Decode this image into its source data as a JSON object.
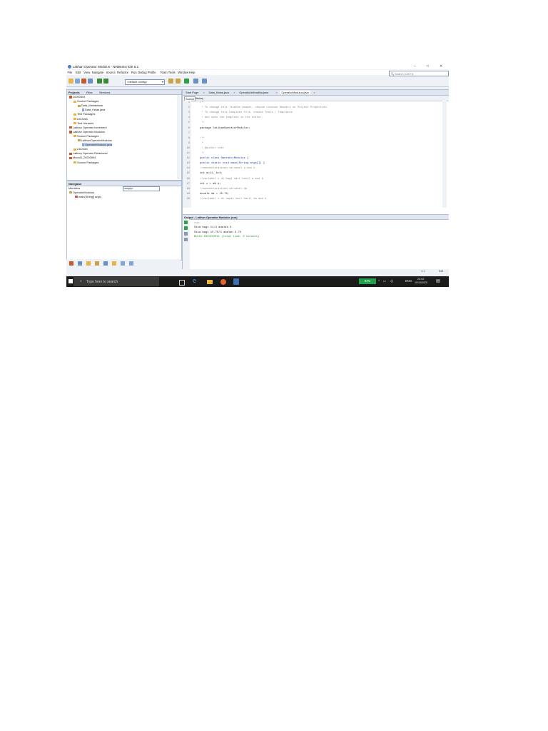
{
  "window": {
    "title": "Latihan Operator Modulus - NetBeans IDE 8.2",
    "controls": [
      "–",
      "□",
      "✕"
    ]
  },
  "menu": {
    "items": [
      "File",
      "Edit",
      "View",
      "Navigate",
      "Source",
      "Refactor",
      "Run",
      "Debug",
      "Profile",
      "Team",
      "Tools",
      "Window",
      "Help"
    ],
    "search_placeholder": "Search (Ctrl+I)"
  },
  "toolbar": {
    "config_value": "<default config>",
    "icons": [
      "new-project-icon",
      "new-file-icon",
      "open-project-icon",
      "save-all-icon",
      "undo-icon",
      "redo-icon",
      "build-icon",
      "clean-build-icon",
      "run-icon",
      "debug-icon",
      "profile-icon"
    ]
  },
  "projects_pane": {
    "tabs": [
      "Projects",
      "Files",
      "Services"
    ],
    "tree": [
      {
        "label": "20200504",
        "type": "project",
        "indent": 0
      },
      {
        "label": "Source Packages",
        "type": "folder",
        "indent": 1
      },
      {
        "label": "Data_Mahasiswa",
        "type": "package",
        "indent": 2
      },
      {
        "label": "Data_Kelas.java",
        "type": "file",
        "indent": 3
      },
      {
        "label": "Test Packages",
        "type": "folder",
        "indent": 1
      },
      {
        "label": "Libraries",
        "type": "folder",
        "indent": 1
      },
      {
        "label": "Test Libraries",
        "type": "folder",
        "indent": 1
      },
      {
        "label": "Latihan Operator Increment",
        "type": "project",
        "indent": 0
      },
      {
        "label": "Latihan Operator Modulus",
        "type": "project",
        "indent": 0
      },
      {
        "label": "Source Packages",
        "type": "folder",
        "indent": 1
      },
      {
        "label": "LatihanOperatorModulus",
        "type": "package",
        "indent": 2
      },
      {
        "label": "OperatorModulus.java",
        "type": "file",
        "indent": 3,
        "selected": true
      },
      {
        "label": "Libraries",
        "type": "folder",
        "indent": 1
      },
      {
        "label": "Latihan Operator Relasional",
        "type": "project",
        "indent": 0
      },
      {
        "label": "Modul3_20200504",
        "type": "project",
        "indent": 0
      },
      {
        "label": "Source Packages",
        "type": "folder",
        "indent": 1
      }
    ]
  },
  "navigator_pane": {
    "title": "Navigator",
    "members_label": "Members",
    "filter_value": "<empty>",
    "tree": [
      {
        "label": "OperatorModulus",
        "indent": 0
      },
      {
        "label": "main(String[] args)",
        "indent": 1
      }
    ]
  },
  "editor": {
    "tabs": [
      {
        "label": "Start Page",
        "active": false
      },
      {
        "label": "Data_Kelas.java",
        "active": false
      },
      {
        "label": "OperatorAritmatika.java",
        "active": false
      },
      {
        "label": "OperatorModulus.java",
        "active": true
      }
    ],
    "source_label": "Source",
    "history_label": "History",
    "lines": [
      {
        "n": "1",
        "text": "/*",
        "cls": "c-comment",
        "indent": 0
      },
      {
        "n": "2",
        "text": " * To change this license header, choose License Headers in Project Properties.",
        "cls": "c-comment",
        "indent": 0
      },
      {
        "n": "3",
        "text": " * To change this template file, choose Tools | Templates",
        "cls": "c-comment",
        "indent": 0
      },
      {
        "n": "4",
        "text": " * and open the template in the editor.",
        "cls": "c-comment",
        "indent": 0
      },
      {
        "n": "5",
        "text": " */",
        "cls": "c-comment",
        "indent": 0
      },
      {
        "n": "6",
        "text": "package latihanOperatorModulus;",
        "cls": "c-plain",
        "indent": 0
      },
      {
        "n": "7",
        "text": "",
        "cls": "c-plain",
        "indent": 0
      },
      {
        "n": "8",
        "text": "/**",
        "cls": "c-comment",
        "indent": 0
      },
      {
        "n": "9",
        "text": " *",
        "cls": "c-comment",
        "indent": 0
      },
      {
        "n": "10",
        "text": " * @author User",
        "cls": "c-comment",
        "indent": 0
      },
      {
        "n": "11",
        "text": " */",
        "cls": "c-comment",
        "indent": 0
      },
      {
        "n": "12",
        "text": "public class OperatorModulus {",
        "cls": "c-kw",
        "indent": 0
      },
      {
        "n": "13",
        "text": "public static void main(String args[]) {",
        "cls": "c-kw",
        "indent": 0
      },
      {
        "n": "14",
        "text": "//mendeklarasikan variabel a dan b",
        "cls": "c-comment",
        "indent": 0
      },
      {
        "n": "15",
        "text": "int a=11, b=4;",
        "cls": "c-plain",
        "indent": 0
      },
      {
        "n": "16",
        "text": "//variabel c di bagi dari hasil a mod b",
        "cls": "c-comment",
        "indent": 0
      },
      {
        "n": "17",
        "text": "int c = a% b;",
        "cls": "c-plain",
        "indent": 0
      },
      {
        "n": "18",
        "text": "//mendeklarasikan variabel da",
        "cls": "c-comment",
        "indent": 0
      },
      {
        "n": "19",
        "text": "double da = 15.75;",
        "cls": "c-plain",
        "indent": 0
      },
      {
        "n": "20",
        "text": "//variabel c di dapat dari hasil da mod b",
        "cls": "c-comment",
        "indent": 0
      }
    ]
  },
  "output": {
    "title": "Output - Latihan Operator Modulus (run)",
    "lines": [
      {
        "text": "run:",
        "color": "#8a8a8a"
      },
      {
        "text": "Sisa bagi 11/4 adalah 3",
        "color": "#222222"
      },
      {
        "text": "Sisa bagi 15.75/4 adalah 3.75",
        "color": "#222222"
      },
      {
        "text": "BUILD SUCCESSFUL (total time: 0 seconds)",
        "color": "#2a8a2a"
      }
    ]
  },
  "statusbar": {
    "position": "1:1",
    "mode": "INS"
  },
  "taskbar": {
    "search_placeholder": "Type here to search",
    "battery": "94%",
    "lang": "ENG",
    "time": "23:02",
    "date": "10/10/2020"
  },
  "colors": {
    "accent": "#3a6fb3",
    "taskbar": "#1b1b1b",
    "battery": "#1f9f4a"
  }
}
